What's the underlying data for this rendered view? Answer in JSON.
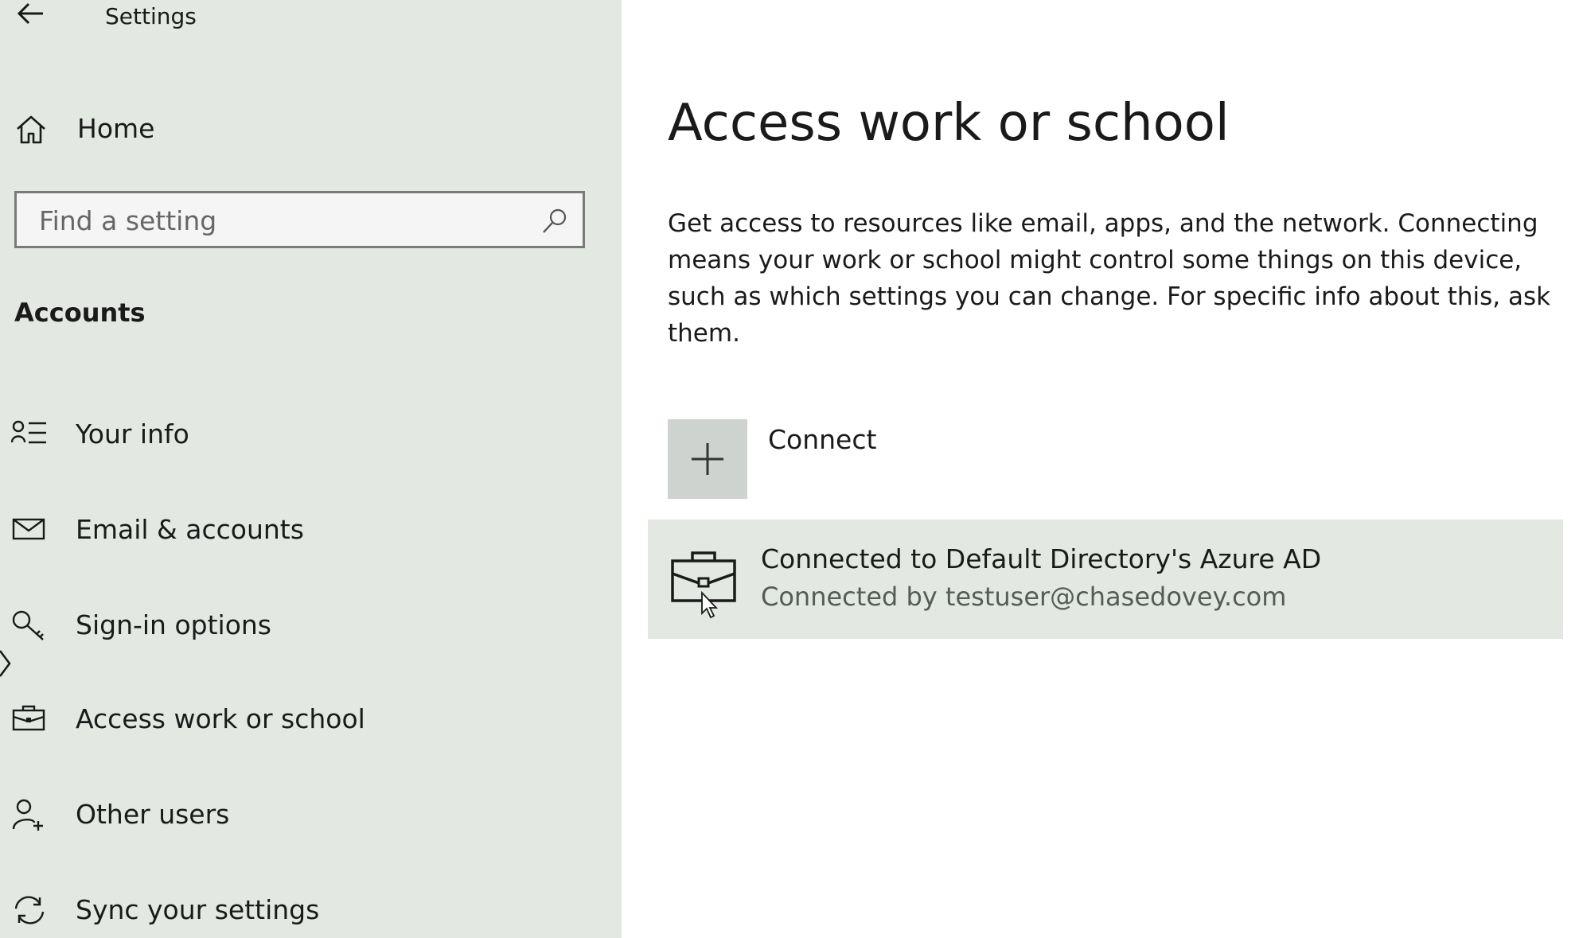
{
  "window": {
    "title": "Settings"
  },
  "sidebar": {
    "home_label": "Home",
    "search": {
      "placeholder": "Find a setting",
      "value": ""
    },
    "section_header": "Accounts",
    "items": [
      {
        "label": "Your info",
        "icon": "your-info-icon"
      },
      {
        "label": "Email & accounts",
        "icon": "email-icon"
      },
      {
        "label": "Sign-in options",
        "icon": "key-icon"
      },
      {
        "label": "Access work or school",
        "icon": "briefcase-icon",
        "selected": true
      },
      {
        "label": "Other users",
        "icon": "add-person-icon"
      },
      {
        "label": "Sync your settings",
        "icon": "sync-icon"
      }
    ]
  },
  "main": {
    "title": "Access work or school",
    "description": "Get access to resources like email, apps, and the network. Connecting means your work or school might control some things on this device, such as which settings you can change. For specific info about this, ask them.",
    "connect_label": "Connect",
    "account": {
      "title": "Connected to Default Directory's Azure AD",
      "subtitle": "Connected by testuser@chasedovey.com"
    }
  },
  "colors": {
    "sidebar_bg": "#e3e8e3",
    "main_bg": "#ffffff",
    "tile_bg": "#cfd3cf",
    "selected_row_bg": "#e3e8e3",
    "text": "#1a1a1a",
    "secondary_text": "#555b57"
  }
}
